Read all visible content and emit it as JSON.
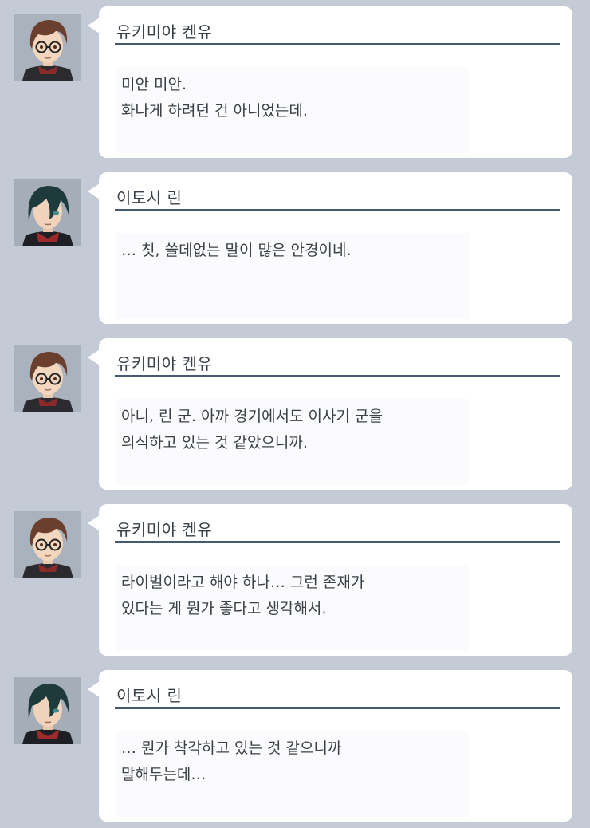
{
  "colors": {
    "background": "#c4cbd7",
    "bubble": "#ffffff",
    "name_rule": "#445a72",
    "text": "#3a4047",
    "kenyu_hair": "#6b3f2e",
    "rin_hair": "#1f3a3b"
  },
  "messages": [
    {
      "speaker": "유키미야 켄유",
      "avatar": "kenyu-glasses-portrait-icon",
      "lines": [
        "미안 미안.",
        "화나게 하려던 건 아니었는데."
      ]
    },
    {
      "speaker": "이토시 린",
      "avatar": "rin-portrait-icon",
      "lines": [
        "… 칫, 쓸데없는 말이 많은 안경이네."
      ]
    },
    {
      "speaker": "유키미야 켄유",
      "avatar": "kenyu-glasses-portrait-icon",
      "lines": [
        "아니, 린 군. 아까 경기에서도 이사기 군을",
        "의식하고 있는 것 같았으니까."
      ]
    },
    {
      "speaker": "유키미야 켄유",
      "avatar": "kenyu-glasses-portrait-icon",
      "lines": [
        "라이벌이라고 해야 하나… 그런 존재가",
        "있다는 게 뭔가 좋다고 생각해서."
      ]
    },
    {
      "speaker": "이토시 린",
      "avatar": "rin-portrait-icon",
      "lines": [
        "… 뭔가 착각하고 있는 것 같으니까",
        "말해두는데…"
      ]
    }
  ]
}
